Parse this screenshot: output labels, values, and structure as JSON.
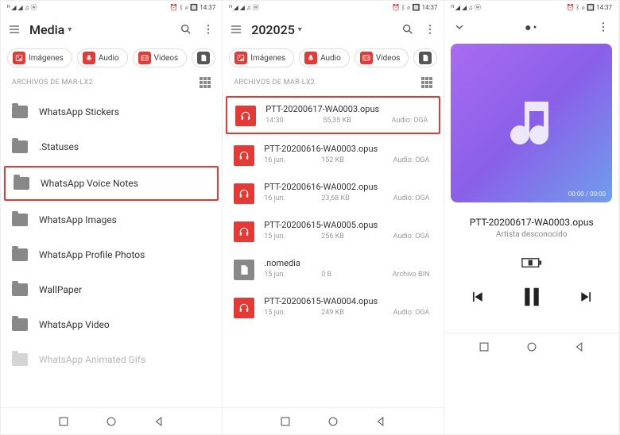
{
  "status": {
    "left_icons": "ᴴ ◢ ◢ ♫ ⓦ",
    "right_icons": "⏰ ᛒ ⌀ 🔲",
    "time": "14:37"
  },
  "panel1": {
    "title": "Media",
    "chips": [
      {
        "icon": "img",
        "label": "Imágenes"
      },
      {
        "icon": "aud",
        "label": "Audio"
      },
      {
        "icon": "vid",
        "label": "Videos"
      },
      {
        "icon": "doc",
        "label": ""
      }
    ],
    "section": "ARCHIVOS DE MAR-LX2",
    "folders": [
      {
        "name": "WhatsApp Stickers",
        "hl": false
      },
      {
        "name": ".Statuses",
        "hl": false
      },
      {
        "name": "WhatsApp Voice Notes",
        "hl": true
      },
      {
        "name": "WhatsApp Images",
        "hl": false
      },
      {
        "name": "WhatsApp Profile Photos",
        "hl": false
      },
      {
        "name": "WallPaper",
        "hl": false
      },
      {
        "name": "WhatsApp Video",
        "hl": false
      },
      {
        "name": "WhatsApp Animated Gifs",
        "hl": false,
        "faded": true
      }
    ]
  },
  "panel2": {
    "title": "202025",
    "chips": [
      {
        "icon": "img",
        "label": "Imágenes"
      },
      {
        "icon": "aud",
        "label": "Audio"
      },
      {
        "icon": "vid",
        "label": "Videos"
      },
      {
        "icon": "doc",
        "label": ""
      }
    ],
    "section": "ARCHIVOS DE MAR-LX2",
    "files": [
      {
        "name": "PTT-20200617-WA0003.opus",
        "date": "14:30",
        "size": "55,35 KB",
        "type": "Audio: OGA",
        "hl": true,
        "plain": false
      },
      {
        "name": "PTT-20200616-WA0003.opus",
        "date": "16 jun.",
        "size": "152 KB",
        "type": "Audio: OGA",
        "hl": false,
        "plain": false
      },
      {
        "name": "PTT-20200616-WA0002.opus",
        "date": "16 jun.",
        "size": "23,68 KB",
        "type": "Audio: OGA",
        "hl": false,
        "plain": false
      },
      {
        "name": "PTT-20200615-WA0005.opus",
        "date": "15 jun.",
        "size": "256 KB",
        "type": "Audio: OGA",
        "hl": false,
        "plain": false
      },
      {
        "name": ".nomedia",
        "date": "15 jun.",
        "size": "0 B",
        "type": "Archivo BIN",
        "hl": false,
        "plain": true
      },
      {
        "name": "PTT-20200615-WA0004.opus",
        "date": "15 jun.",
        "size": "249 KB",
        "type": "Audio: OGA",
        "hl": false,
        "plain": false
      }
    ]
  },
  "panel3": {
    "time_label": "00:00 / 00:00",
    "track_title": "PTT-20200617-WA0003.opus",
    "track_artist": "Artista desconocido"
  }
}
